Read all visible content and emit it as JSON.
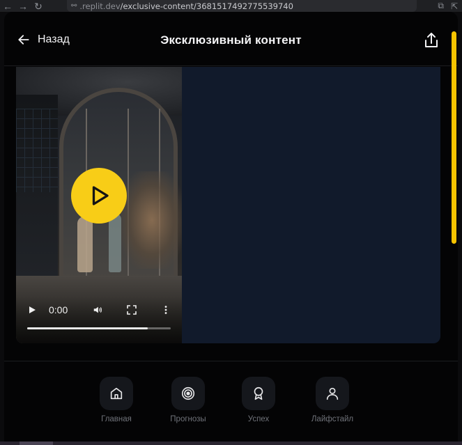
{
  "browser": {
    "url_host": ".replit.dev",
    "url_path": "/exclusive-content/3681517492775539740"
  },
  "header": {
    "back_label": "Назад",
    "title": "Эксклюзивный контент"
  },
  "video": {
    "current_time": "0:00",
    "progress": 0.84
  },
  "nav": {
    "items": [
      {
        "label": "Главная",
        "icon": "home-icon"
      },
      {
        "label": "Прогнозы",
        "icon": "target-icon"
      },
      {
        "label": "Успех",
        "icon": "award-icon"
      },
      {
        "label": "Лайфстайл",
        "icon": "user-icon"
      }
    ]
  },
  "colors": {
    "accent": "#f8cd17",
    "background": "#040405",
    "card": "#111a2b",
    "nav_label": "#6f7279"
  }
}
